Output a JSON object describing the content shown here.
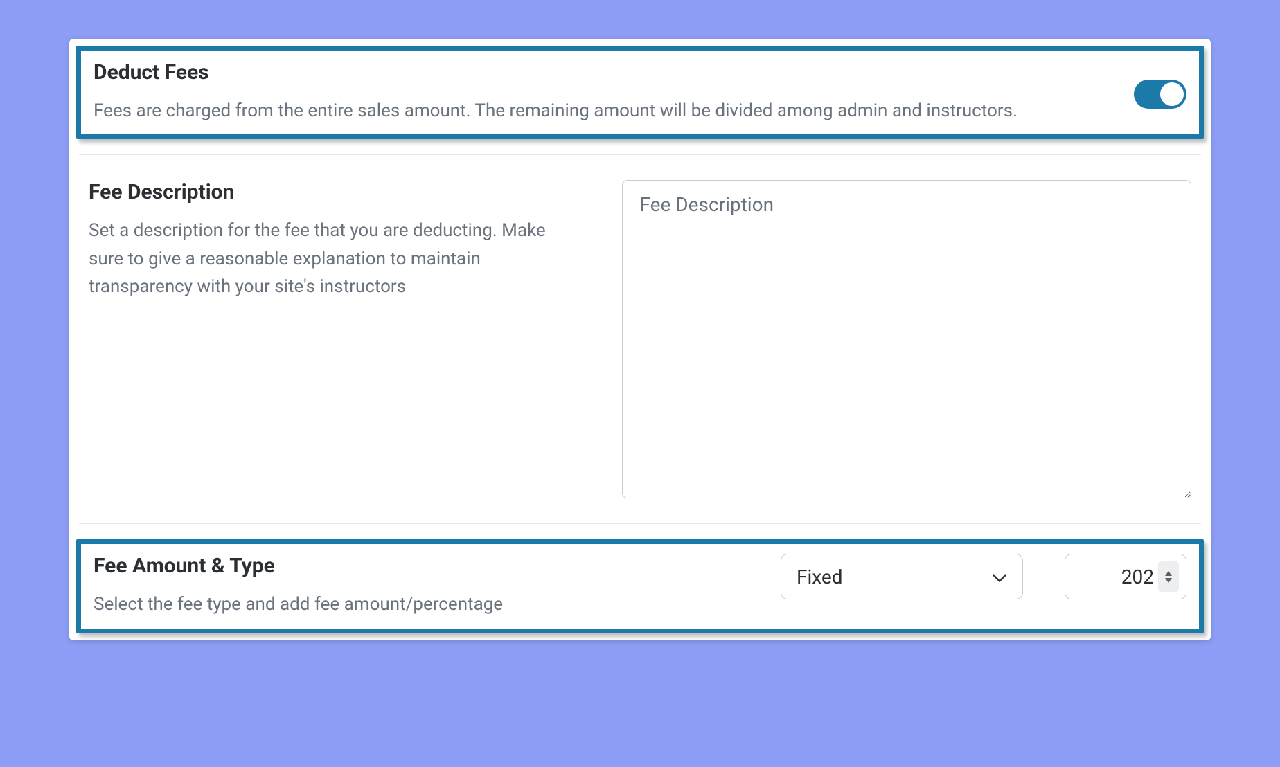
{
  "deductFees": {
    "title": "Deduct Fees",
    "desc": "Fees are charged from the entire sales amount. The remaining amount will be divided among admin and instructors.",
    "enabled": true
  },
  "feeDescription": {
    "title": "Fee Description",
    "desc": "Set a description for the fee that you are deducting. Make sure to give a reasonable explanation to maintain transparency with your site's instructors",
    "placeholder": "Fee Description",
    "value": ""
  },
  "feeAmount": {
    "title": "Fee Amount & Type",
    "desc": "Select the fee type and add fee amount/percentage",
    "type": "Fixed",
    "amount": "202"
  }
}
